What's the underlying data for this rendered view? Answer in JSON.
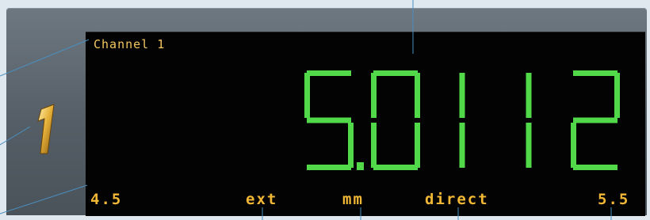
{
  "display": {
    "channel_label": "Channel 1",
    "reading": "5.0112",
    "digits": [
      "5",
      "0",
      "1",
      "1",
      "2"
    ],
    "decimal_after_index": 0,
    "lower_limit": "4.5",
    "upper_limit": "5.5",
    "input_mode": "ext",
    "unit": "mm",
    "mode": "direct",
    "channel_number": "1"
  },
  "colors": {
    "segment_on": "#52d94a",
    "label_text": "#f2b835",
    "screen_bg": "#030303",
    "channel_number_gold": "#e7b23a",
    "callout_line": "#4a8fc0"
  }
}
